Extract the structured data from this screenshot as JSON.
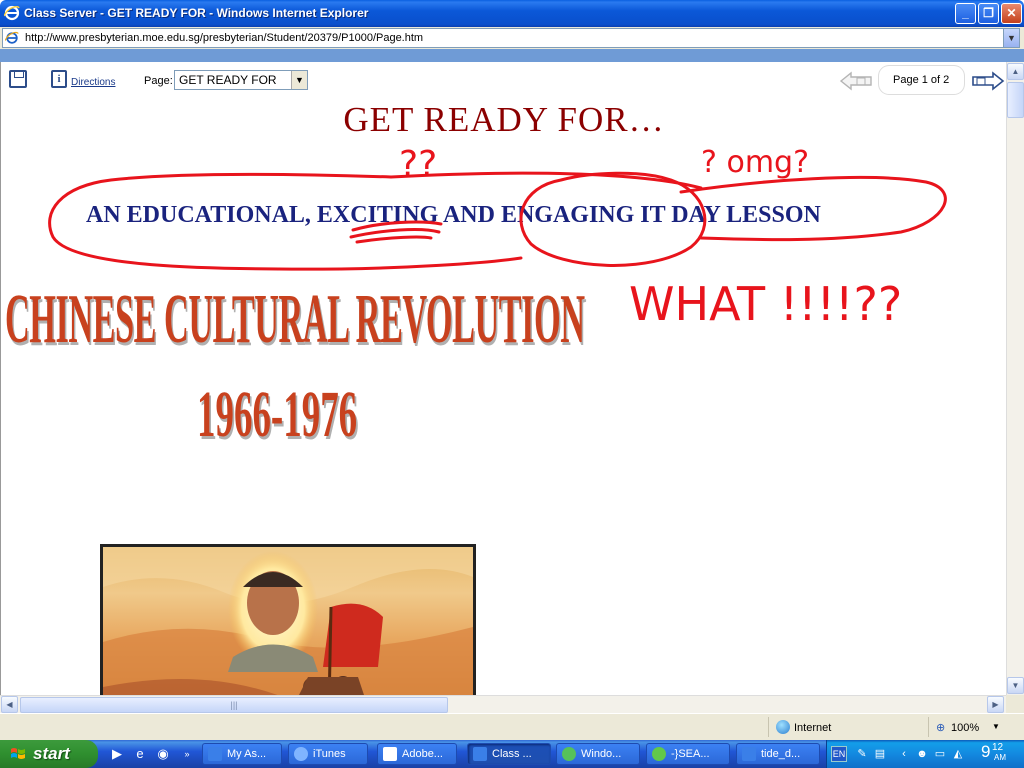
{
  "window": {
    "title": "Class Server - GET READY FOR - Windows Internet Explorer",
    "controls": {
      "minimize": "_",
      "maximize": "❐",
      "close": "✕"
    }
  },
  "address_bar": {
    "url": "http://www.presbyterian.moe.edu.sg/presbyterian/Student/20379/P1000/Page.htm"
  },
  "class_toolbar": {
    "directions_label": "Directions",
    "page_label": "Page:",
    "page_select_value": "GET READY FOR",
    "page_indicator": "Page  1 of 2"
  },
  "document": {
    "title": "GET READY FOR…",
    "subtitle": "AN EDUCATIONAL, EXCITING AND ENGAGING IT DAY LESSON",
    "hero_title": "CHINESE CULTURAL REVOLUTION",
    "hero_years": "1966-1976"
  },
  "annotations": {
    "question_marks": "??",
    "omg": "? omg?",
    "what": "WHAT !!!!??",
    "ink_color": "#e8141c"
  },
  "status_bar": {
    "zone": "Internet",
    "zoom": "100%"
  },
  "taskbar": {
    "start_label": "start",
    "tasks": [
      {
        "label": "My As...",
        "icon": "ie-icon"
      },
      {
        "label": "iTunes",
        "icon": "itunes-icon"
      },
      {
        "label": "Adobe...",
        "icon": "adobe-icon"
      },
      {
        "label": "Class ...",
        "icon": "ie-icon",
        "active": true
      },
      {
        "label": "Windo...",
        "icon": "messenger-icon"
      },
      {
        "label": "-}SEA...",
        "icon": "chat-icon"
      },
      {
        "label": "tide_d...",
        "icon": "ie-icon"
      }
    ],
    "tray": {
      "language": "EN",
      "clock_hour": "9",
      "clock_minutes": "12",
      "clock_ampm": "AM"
    }
  },
  "colors": {
    "title_color": "#8b0000",
    "subtitle_color": "#1a237e",
    "hero_color": "#c8411e",
    "titlebar_blue": "#0b58d8",
    "taskbar_blue": "#2157d7",
    "start_green": "#2f8f2f"
  }
}
